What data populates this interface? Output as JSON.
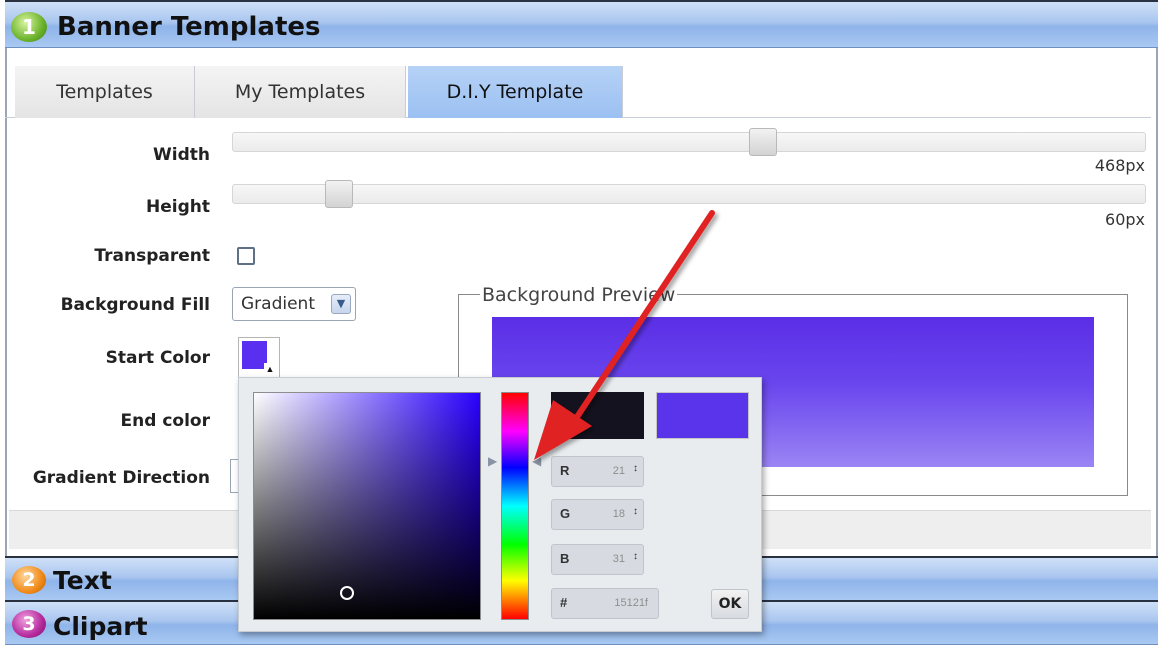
{
  "sections": [
    {
      "number": "1",
      "title": "Banner Templates",
      "color": "#6bb32b"
    },
    {
      "number": "2",
      "title": "Text",
      "color": "#f08a18"
    },
    {
      "number": "3",
      "title": "Clipart",
      "color": "#b52a9d"
    }
  ],
  "tabs": [
    {
      "label": "Templates"
    },
    {
      "label": "My Templates"
    },
    {
      "label": "D.I.Y Template",
      "active": true
    }
  ],
  "form": {
    "width": {
      "label": "Width",
      "value": "468px"
    },
    "height": {
      "label": "Height",
      "value": "60px"
    },
    "transparent": {
      "label": "Transparent",
      "checked": false
    },
    "background_fill": {
      "label": "Background Fill",
      "selected": "Gradient"
    },
    "start_color": {
      "label": "Start Color",
      "color": "#5b2ff0"
    },
    "end_color": {
      "label": "End color"
    },
    "gradient_direction": {
      "label": "Gradient Direction"
    }
  },
  "preview": {
    "legend": "Background Preview",
    "colors": [
      "#5b2ee6",
      "#9a85f4"
    ]
  },
  "color_picker": {
    "new_color": "#15121f",
    "current_color": "#5a34ea",
    "r": {
      "label": "R",
      "value": "21"
    },
    "g": {
      "label": "G",
      "value": "18"
    },
    "b": {
      "label": "B",
      "value": "31"
    },
    "hex": {
      "label": "#",
      "value": "15121f"
    },
    "ok_label": "OK"
  },
  "annotation": {
    "color": "#e02020",
    "icon": "red-arrow-pointing-to-hue-slider"
  }
}
